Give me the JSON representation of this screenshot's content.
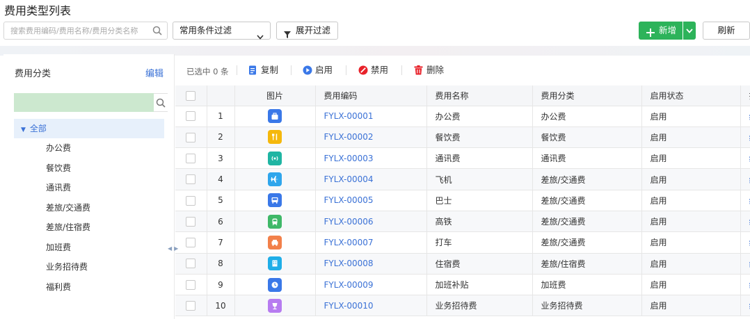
{
  "page": {
    "title": "费用类型列表"
  },
  "search": {
    "placeholder": "搜索费用编码/费用名称/费用分类名称",
    "icon": "search-icon"
  },
  "filter_select": {
    "value": "常用条件过滤"
  },
  "expand_filter": {
    "label": "展开过滤",
    "icon": "filter-icon"
  },
  "add_button": {
    "label": "新增",
    "color": "#2db35a"
  },
  "refresh_button": {
    "label": "刷新"
  },
  "sidebar": {
    "title": "费用分类",
    "edit_label": "编辑",
    "root": "全部",
    "items": [
      "办公费",
      "餐饮费",
      "通讯费",
      "差旅/交通费",
      "差旅/住宿费",
      "加班费",
      "业务招待费",
      "福利费"
    ]
  },
  "toolbar": {
    "selected_text": "已选中 0 条",
    "copy_label": "复制",
    "enable_label": "启用",
    "disable_label": "禁用",
    "delete_label": "删除"
  },
  "table": {
    "headers": [
      "图片",
      "费用编码",
      "费用名称",
      "费用分类",
      "启用状态",
      "操"
    ],
    "rows": [
      {
        "index": "1",
        "icon": "briefcase-icon",
        "color": "#3a78e8",
        "code": "FYLX-00001",
        "name": "办公费",
        "category": "办公费",
        "status": "启用",
        "action": "编"
      },
      {
        "index": "2",
        "icon": "fork-knife-icon",
        "color": "#f5b80c",
        "code": "FYLX-00002",
        "name": "餐饮费",
        "category": "餐饮费",
        "status": "启用",
        "action": "编"
      },
      {
        "index": "3",
        "icon": "signal-icon",
        "color": "#1fb5a3",
        "code": "FYLX-00003",
        "name": "通讯费",
        "category": "通讯费",
        "status": "启用",
        "action": "编"
      },
      {
        "index": "4",
        "icon": "plane-icon",
        "color": "#2fa6ec",
        "code": "FYLX-00004",
        "name": "飞机",
        "category": "差旅/交通费",
        "status": "启用",
        "action": "编"
      },
      {
        "index": "5",
        "icon": "bus-icon",
        "color": "#3a78e8",
        "code": "FYLX-00005",
        "name": "巴士",
        "category": "差旅/交通费",
        "status": "启用",
        "action": "编"
      },
      {
        "index": "6",
        "icon": "train-icon",
        "color": "#3fb868",
        "code": "FYLX-00006",
        "name": "高铁",
        "category": "差旅/交通费",
        "status": "启用",
        "action": "编"
      },
      {
        "index": "7",
        "icon": "taxi-icon",
        "color": "#f2804a",
        "code": "FYLX-00007",
        "name": "打车",
        "category": "差旅/交通费",
        "status": "启用",
        "action": "编"
      },
      {
        "index": "8",
        "icon": "hotel-icon",
        "color": "#1faee8",
        "code": "FYLX-00008",
        "name": "住宿费",
        "category": "差旅/住宿费",
        "status": "启用",
        "action": "编"
      },
      {
        "index": "9",
        "icon": "clock-icon",
        "color": "#3a78e8",
        "code": "FYLX-00009",
        "name": "加班补贴",
        "category": "加班费",
        "status": "启用",
        "action": "编"
      },
      {
        "index": "10",
        "icon": "cup-icon",
        "color": "#b77cf0",
        "code": "FYLX-00010",
        "name": "业务招待费",
        "category": "业务招待费",
        "status": "启用",
        "action": "编"
      }
    ]
  }
}
